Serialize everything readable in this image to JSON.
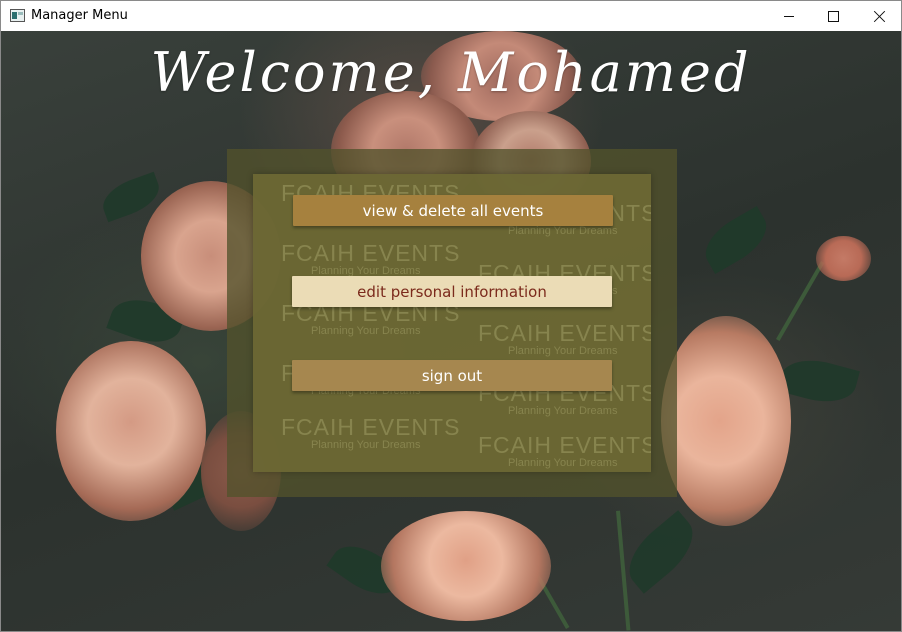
{
  "window": {
    "title": "Manager Menu",
    "icon": "app-window-icon"
  },
  "welcome": {
    "text": "Welcome, Mohamed"
  },
  "watermark": {
    "brand": "FCAIH EVENTS",
    "tagline": "Planning Your Dreams"
  },
  "menu": {
    "view_delete_label": "view & delete all events",
    "edit_info_label": "edit personal information",
    "sign_out_label": "sign out"
  },
  "colors": {
    "button_primary": "#a6813e",
    "button_highlight": "#ebdcb6",
    "highlight_text": "#7b2a1c",
    "panel": "#6c6834"
  }
}
